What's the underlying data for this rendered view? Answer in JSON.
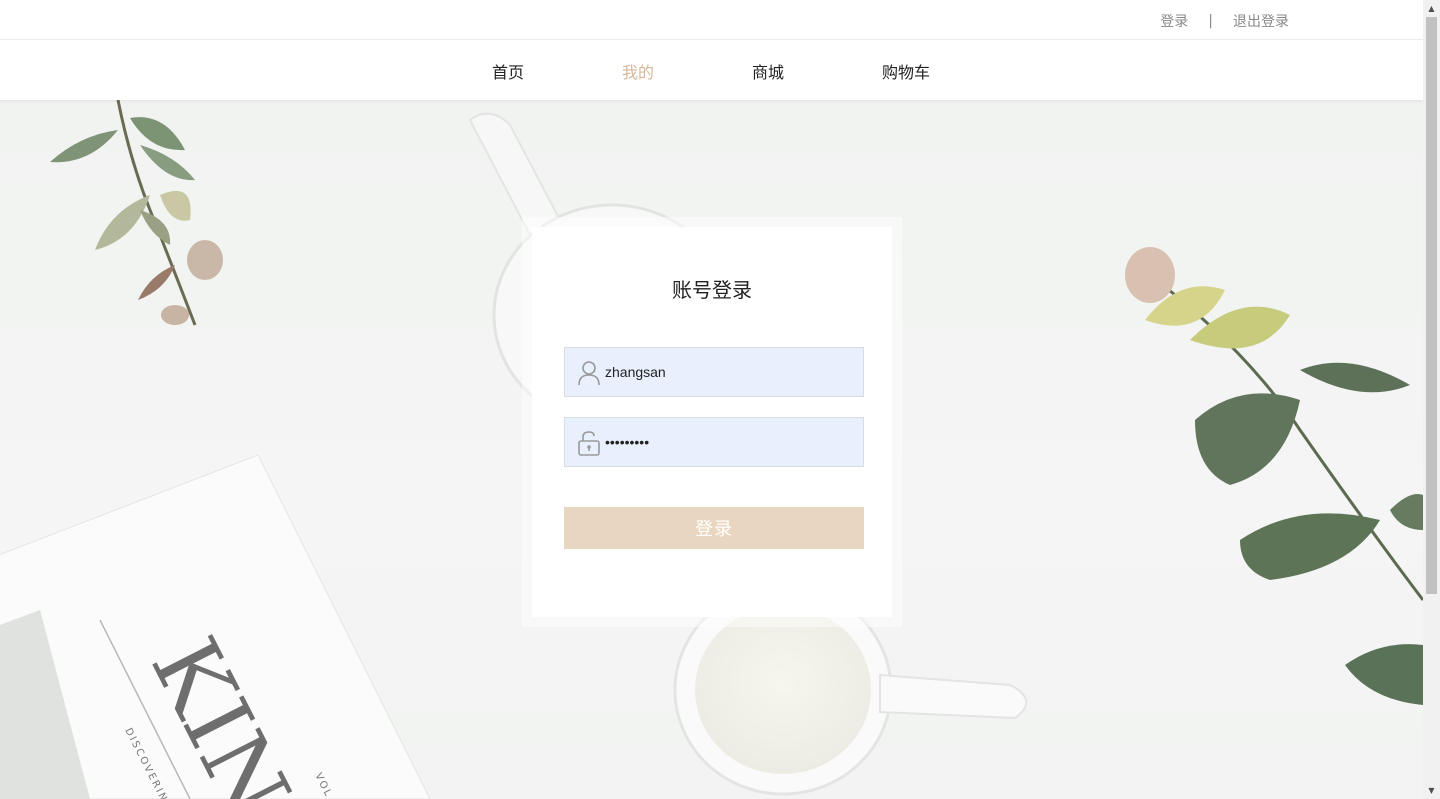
{
  "topbar": {
    "login_link": "登录",
    "separator": "|",
    "logout_link": "退出登录"
  },
  "nav": {
    "items": [
      {
        "label": "首页",
        "active": false
      },
      {
        "label": "我的",
        "active": true
      },
      {
        "label": "商城",
        "active": false
      },
      {
        "label": "购物车",
        "active": false
      }
    ]
  },
  "login": {
    "title": "账号登录",
    "username_value": "zhangsan",
    "password_value": "123456789",
    "submit_label": "登录"
  },
  "background": {
    "book_text": "KIN",
    "book_subtext_left": "DISCOVERIN",
    "book_subtext_right": "VOL"
  },
  "colors": {
    "accent": "#d4b89a",
    "button": "#e9d6c1",
    "input_bg": "#e8f0fe",
    "muted_text": "#888888"
  }
}
